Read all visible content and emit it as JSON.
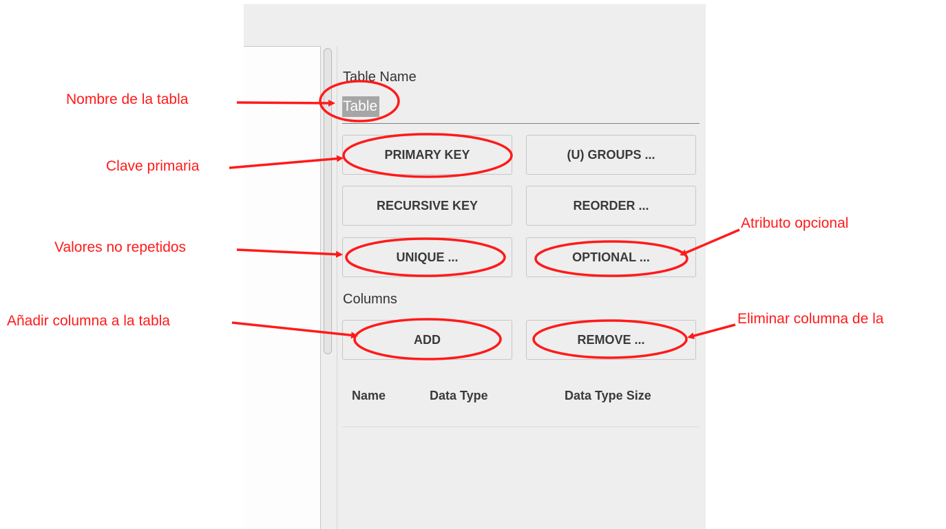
{
  "panel": {
    "table_name_label": "Table Name",
    "table_name_value": "Table",
    "columns_label": "Columns",
    "buttons": {
      "primary_key": "PRIMARY KEY",
      "groups": "(U) GROUPS ...",
      "recursive_key": "RECURSIVE KEY",
      "reorder": "REORDER ...",
      "unique": "UNIQUE ...",
      "optional": "OPTIONAL ...",
      "add": "ADD",
      "remove": "REMOVE ..."
    },
    "column_headers": [
      "Name",
      "Data Type",
      "Data Type Size"
    ]
  },
  "annotations": {
    "table_name": "Nombre de la tabla",
    "primary_key": "Clave primaria",
    "unique": "Valores no repetidos",
    "optional": "Atributo opcional",
    "add": "Añadir columna a la tabla",
    "remove": "Eliminar columna de la"
  },
  "colors": {
    "annotation": "#ff1a1a",
    "panel_bg": "#eeeeee",
    "selection": "#a6a6a6"
  }
}
